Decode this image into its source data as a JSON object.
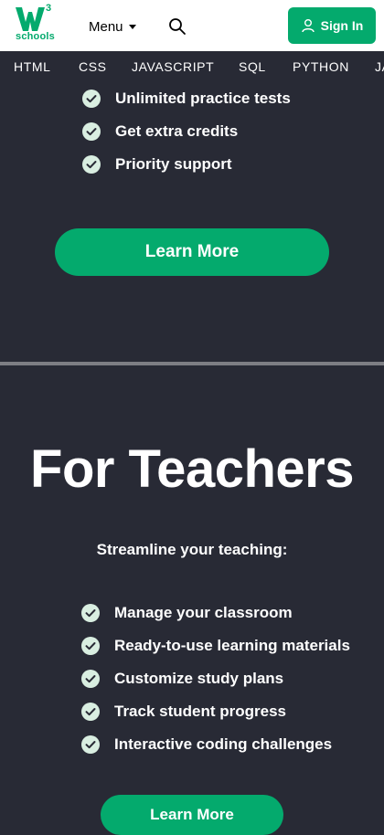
{
  "header": {
    "logo_sup": "3",
    "logo_text": "schools",
    "menu_label": "Menu",
    "signin_label": "Sign In"
  },
  "nav": {
    "items": [
      "HTML",
      "CSS",
      "JAVASCRIPT",
      "SQL",
      "PYTHON",
      "JA"
    ]
  },
  "students_features": {
    "items": [
      "Unlimited practice tests",
      "Get extra credits",
      "Priority support"
    ],
    "button": "Learn More"
  },
  "teachers": {
    "title": "For Teachers",
    "subtitle": "Streamline your teaching:",
    "items": [
      "Manage your classroom",
      "Ready-to-use learning materials",
      "Customize study plans",
      "Track student progress",
      "Interactive coding challenges"
    ],
    "button": "Learn More"
  },
  "colors": {
    "accent": "#04aa6d",
    "background": "#282a35",
    "check_fill": "#d9eee1"
  },
  "icons": {
    "search": "search-icon",
    "user": "user-icon",
    "check": "check-circle-icon"
  }
}
